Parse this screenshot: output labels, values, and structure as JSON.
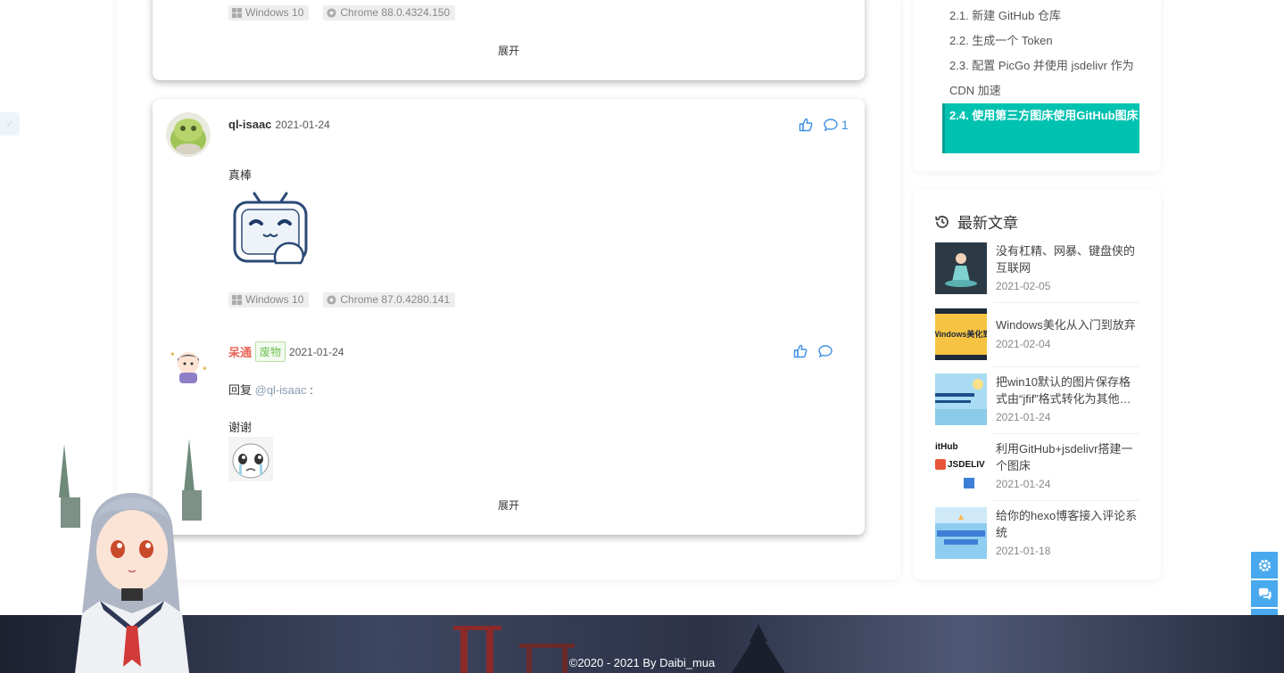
{
  "top_comment": {
    "tags": [
      {
        "icon": "windows-icon",
        "text": "Windows 10"
      },
      {
        "icon": "chrome-icon",
        "text": "Chrome 88.0.4324.150"
      }
    ],
    "expand_label": "展开"
  },
  "comment": {
    "nick": "ql-isaac",
    "date": "2021-01-24",
    "like_icon": "thumbs-up-icon",
    "reply_icon": "comment-icon",
    "reply_count": "1",
    "text": "真棒",
    "tags": [
      {
        "icon": "windows-icon",
        "text": "Windows 10"
      },
      {
        "icon": "chrome-icon",
        "text": "Chrome 87.0.4280.141"
      }
    ],
    "reply": {
      "nick": "呆通",
      "badge": "废物",
      "date": "2021-01-24",
      "reply_prefix": "回复 ",
      "mention": "@ql-isaac",
      "mention_suffix": " :",
      "text": "谢谢"
    },
    "expand_label": "展开"
  },
  "toc": {
    "items": [
      "2.1. 新建 GitHub 仓库",
      "2.2. 生成一个 Token",
      "2.3. 配置 PicGo 并使用 jsdelivr 作为 CDN 加速"
    ],
    "active": "2.4. 使用第三方图床使用GitHub图床"
  },
  "recent": {
    "title": "最新文章",
    "icon": "history-icon",
    "posts": [
      {
        "title": "没有杠精、网暴、键盘侠的互联网",
        "date": "2021-02-05",
        "thumb_color": "#2c3a45"
      },
      {
        "title": "Windows美化从入门到放弃",
        "date": "2021-02-04",
        "thumb_color": "#f6c343",
        "thumb_text": "Windows美化到"
      },
      {
        "title": "把win10默认的图片保存格式由“jfif”格式转化为其他…",
        "date": "2021-01-24",
        "thumb_color": "#9bd4ef"
      },
      {
        "title": "利用GitHub+jsdelivr搭建一个图床",
        "date": "2021-01-24",
        "thumb_color": "#ffffff",
        "thumb_text": "itHub JSDELIV"
      },
      {
        "title": "给你的hexo博客接入评论系统",
        "date": "2021-01-18",
        "thumb_color": "#7fc4ee"
      }
    ]
  },
  "fixed_buttons": [
    "gear-icon",
    "chat-icon",
    "arrow-up-icon"
  ],
  "footer": {
    "text": "©2020 - 2021 By Daibi_mua"
  }
}
